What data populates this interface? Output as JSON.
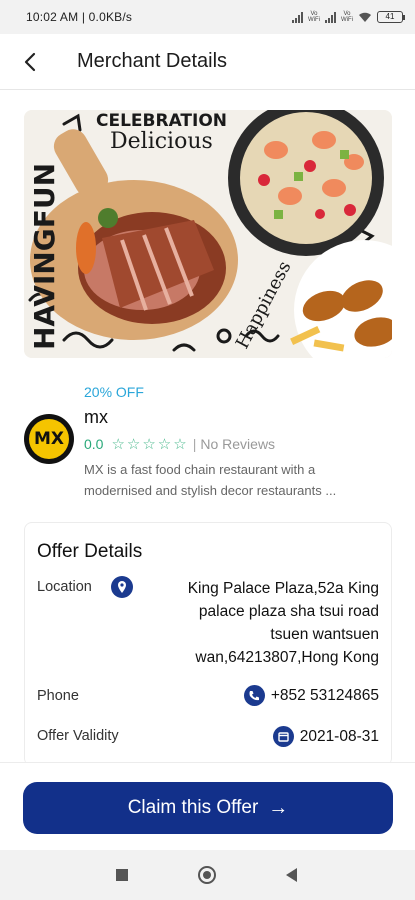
{
  "status_bar": {
    "time": "10:02 AM | 0.0KB/s",
    "network_label_1": "Vo\nWiFi",
    "network_label_2": "Vo\nWiFi",
    "battery": "41"
  },
  "header": {
    "title": "Merchant Details",
    "back_icon": "chevron-left-icon"
  },
  "hero": {
    "text_top": "CELEBRATION",
    "text_delicious": "Delicious",
    "text_left": "HAVINGFUN",
    "text_right": "Happiness"
  },
  "merchant": {
    "offer_tag": "20% OFF",
    "logo_text": "MX",
    "name": "mx",
    "rating": "0.0",
    "stars": "☆☆☆☆☆",
    "reviews": "No Reviews",
    "description": "MX is a fast food chain restaurant  with a modernised and stylish decor restaurants ..."
  },
  "offer_details": {
    "title": "Offer Details",
    "location_label": "Location",
    "location_value": "King Palace Plaza,52a King palace plaza sha tsui road tsuen wantsuen wan,64213807,Hong Kong",
    "phone_label": "Phone",
    "phone_value": "+852 53124865",
    "validity_label": "Offer Validity",
    "validity_value": "2021-08-31"
  },
  "cta": {
    "label": "Claim this Offer",
    "arrow": "→"
  },
  "colors": {
    "primary": "#12308a",
    "accent_blue": "#2aa6d9",
    "rating_green": "#2aa97a",
    "logo_yellow": "#f5c400"
  }
}
